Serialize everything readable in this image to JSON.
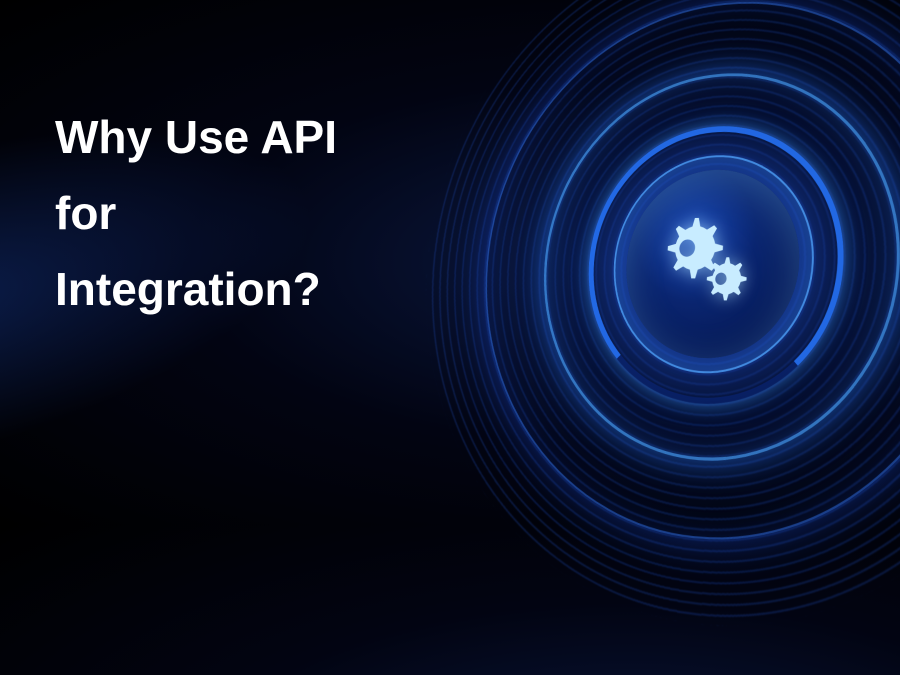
{
  "heading": {
    "line1": "Why Use API",
    "line2": "for",
    "line3": "Integration?"
  },
  "graphic": {
    "icon_name": "gears-icon"
  },
  "colors": {
    "text": "#ffffff",
    "accent_blue": "#1a4ab8",
    "glow": "#3c96ff",
    "icon": "#c8ecff"
  }
}
